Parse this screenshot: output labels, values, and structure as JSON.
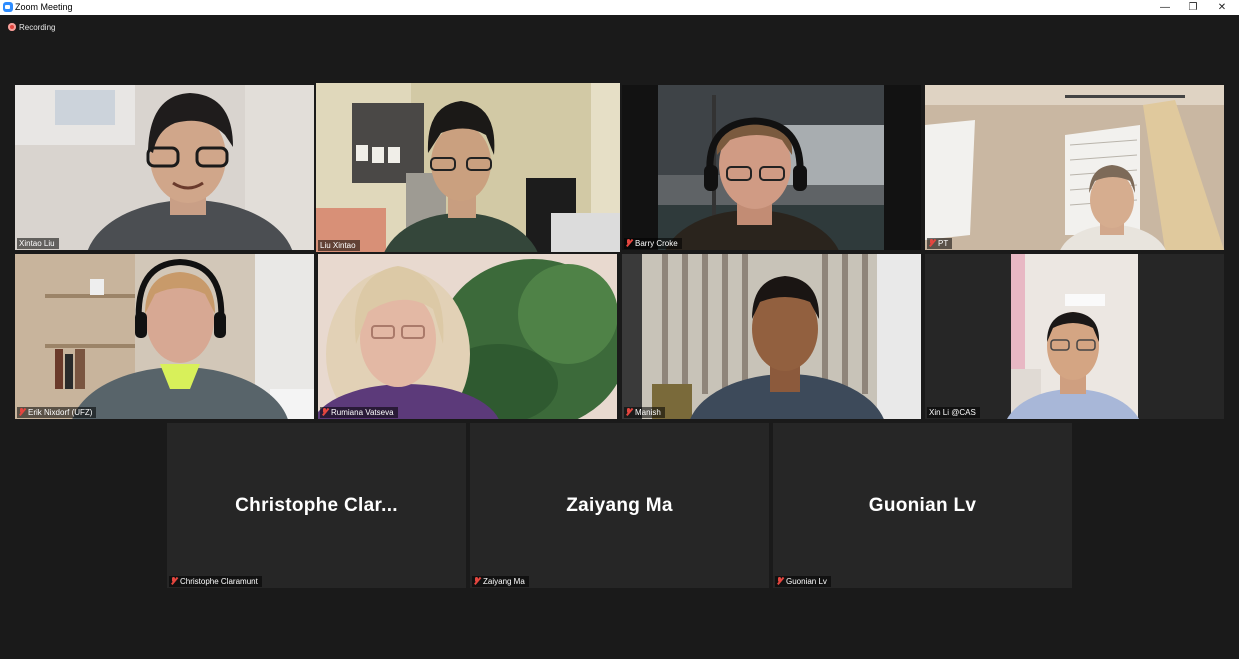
{
  "window": {
    "title": "Zoom Meeting",
    "minimize_glyph": "—",
    "restore_glyph": "❐",
    "close_glyph": "✕"
  },
  "recording": {
    "label": "Recording"
  },
  "participants": [
    {
      "name": "Xintao Liu",
      "muted": false,
      "active_speaker": false,
      "video": true
    },
    {
      "name": "Liu Xintao",
      "muted": false,
      "active_speaker": true,
      "video": true
    },
    {
      "name": "Barry Croke",
      "muted": true,
      "active_speaker": false,
      "video": true
    },
    {
      "name": "PT",
      "muted": true,
      "active_speaker": false,
      "video": true
    },
    {
      "name": "Erik Nixdorf (UFZ)",
      "muted": true,
      "active_speaker": false,
      "video": true
    },
    {
      "name": "Rumiana Vatseva",
      "muted": true,
      "active_speaker": false,
      "video": true
    },
    {
      "name": "Manish",
      "muted": true,
      "active_speaker": false,
      "video": true
    },
    {
      "name": "Xin Li @CAS",
      "muted": false,
      "active_speaker": false,
      "video": true
    },
    {
      "name": "Christophe Claramunt",
      "display_name": "Christophe  Clar...",
      "muted": true,
      "video": false
    },
    {
      "name": "Zaiyang Ma",
      "display_name": "Zaiyang Ma",
      "muted": true,
      "video": false
    },
    {
      "name": "Guonian Lv",
      "display_name": "Guonian Lv",
      "muted": true,
      "video": false
    }
  ],
  "colors": {
    "background": "#1a1a1a",
    "tile": "#262626",
    "active_border": "#c4e05a",
    "muted_icon": "#e4463f"
  }
}
